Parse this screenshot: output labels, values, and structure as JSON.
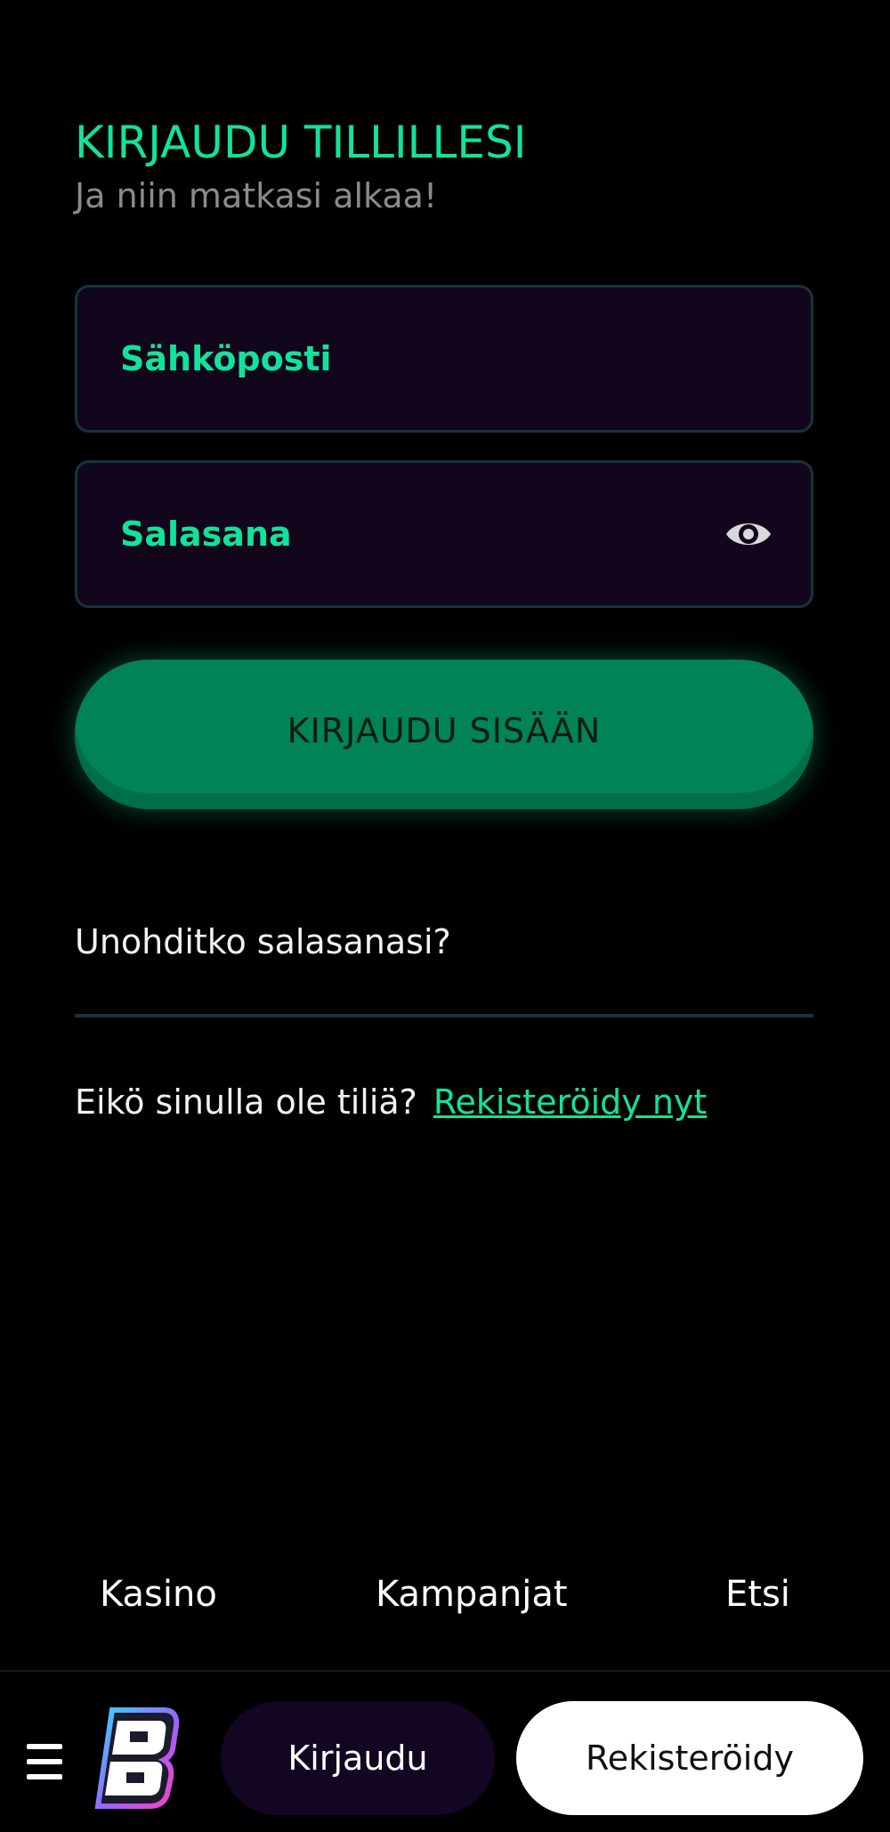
{
  "login": {
    "title": "KIRJAUDU TILLILLESI",
    "subtitle": "Ja niin matkasi alkaa!",
    "email_placeholder": "Sähköposti",
    "password_placeholder": "Salasana",
    "submit_label": "KIRJAUDU SISÄÄN",
    "forgot_label": "Unohditko salasanasi?",
    "no_account_text": "Eikö sinulla ole tiliä?",
    "register_link_label": "Rekisteröidy nyt"
  },
  "nav": {
    "items": [
      {
        "label": "Kasino"
      },
      {
        "label": "Kampanjat"
      },
      {
        "label": "Etsi"
      }
    ]
  },
  "bottom_bar": {
    "login_label": "Kirjaudu",
    "register_label": "Rekisteröidy"
  },
  "icons": {
    "password": "eye-icon",
    "menu": "hamburger-menu-icon",
    "logo": "brand-logo-b"
  },
  "colors": {
    "accent": "#12e39a",
    "button": "#008457",
    "field_bg": "#12061d",
    "field_border": "#16343a",
    "background": "#000000"
  }
}
